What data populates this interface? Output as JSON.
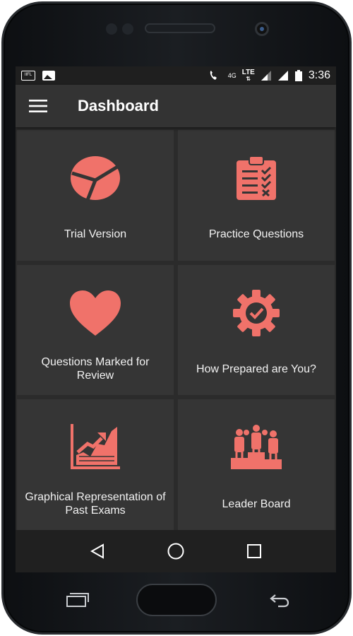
{
  "status_bar": {
    "left_icons": [
      "notification-icon",
      "image-icon"
    ],
    "notif_text": "IIFL",
    "network_4g": "4G",
    "network_lte": "LTE",
    "time": "3:36"
  },
  "app_bar": {
    "title": "Dashboard",
    "menu_icon": "hamburger-icon"
  },
  "tiles": [
    {
      "label": "Trial Version",
      "icon": "pie-chart-icon"
    },
    {
      "label": "Practice Questions",
      "icon": "clipboard-checklist-icon"
    },
    {
      "label": "Questions Marked for Review",
      "icon": "heart-icon"
    },
    {
      "label": "How Prepared are You?",
      "icon": "gear-check-icon"
    },
    {
      "label": "Graphical Representation of Past Exams",
      "icon": "growth-chart-icon"
    },
    {
      "label": "Leader Board",
      "icon": "podium-people-icon"
    }
  ],
  "nav_bar": {
    "back_icon": "back-triangle-icon",
    "home_icon": "home-circle-icon",
    "recents_icon": "recents-square-icon"
  },
  "colors": {
    "accent": "#F0726A",
    "background": "#2B2B2B",
    "tile": "#353535",
    "app_bar": "#333333",
    "status_bar": "#1F1F1F",
    "nav_bar": "#202020"
  }
}
